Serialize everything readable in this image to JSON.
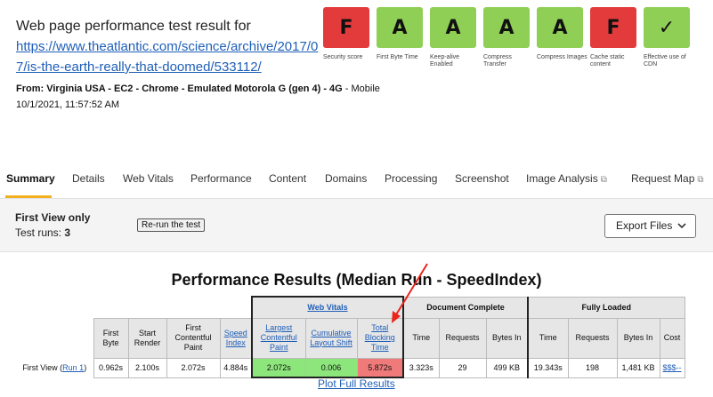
{
  "header": {
    "title": "Web page performance test result for",
    "url": "https://www.theatlantic.com/science/archive/2017/07/is-the-earth-really-that-doomed/533112/",
    "from_prefix": "From: ",
    "from_location": "Virginia USA - EC2 - Chrome - Emulated Motorola G (gen 4) - 4G",
    "from_suffix": " - Mobile",
    "date": "10/1/2021, 11:57:52 AM"
  },
  "grades": [
    {
      "grade": "F",
      "label": "Security score",
      "color": "#e33b3b"
    },
    {
      "grade": "A",
      "label": "First Byte Time",
      "color": "#8fcf55"
    },
    {
      "grade": "A",
      "label": "Keep-alive Enabled",
      "color": "#8fcf55"
    },
    {
      "grade": "A",
      "label": "Compress Transfer",
      "color": "#8fcf55"
    },
    {
      "grade": "A",
      "label": "Compress Images",
      "color": "#8fcf55"
    },
    {
      "grade": "F",
      "label": "Cache static content",
      "color": "#e33b3b"
    },
    {
      "grade": "✓",
      "label": "Effective use of CDN",
      "color": "#8fcf55"
    }
  ],
  "tabs": [
    "Summary",
    "Details",
    "Web Vitals",
    "Performance",
    "Content",
    "Domains",
    "Processing",
    "Screenshot",
    "Image Analysis",
    "Request Map"
  ],
  "run_info": {
    "first_view": "First View only",
    "test_runs_label": "Test runs: ",
    "test_runs_value": "3",
    "rerun_label": "Re-run the test",
    "export_label": "Export Files",
    "export_icon": "chevron-down-icon"
  },
  "results": {
    "title": "Performance Results (Median Run - SpeedIndex)",
    "groups": {
      "web_vitals": "Web Vitals",
      "document_complete": "Document Complete",
      "fully_loaded": "Fully Loaded"
    },
    "headers": {
      "first_byte": "First Byte",
      "start_render": "Start Render",
      "fcp": "First Contentful Paint",
      "speed_index": "Speed Index",
      "lcp": "Largest Contentful Paint",
      "cls": "Cumulative Layout Shift",
      "tbt": "Total Blocking Time",
      "dc_time": "Time",
      "dc_requests": "Requests",
      "dc_bytes": "Bytes In",
      "fl_time": "Time",
      "fl_requests": "Requests",
      "fl_bytes": "Bytes In",
      "cost": "Cost"
    },
    "row": {
      "label": "First View (",
      "run_link": "Run 1",
      "label_end": ")",
      "first_byte": "0.962s",
      "start_render": "2.100s",
      "fcp": "2.072s",
      "speed_index": "4.884s",
      "lcp": "2.072s",
      "cls": "0.006",
      "tbt": "5.872s",
      "dc_time": "3.323s",
      "dc_requests": "29",
      "dc_bytes": "499 KB",
      "fl_time": "19.343s",
      "fl_requests": "198",
      "fl_bytes": "1,481 KB",
      "cost": "$$$--"
    },
    "plot_link": "Plot Full Results",
    "annotation_arrow_color": "#e8261c"
  }
}
